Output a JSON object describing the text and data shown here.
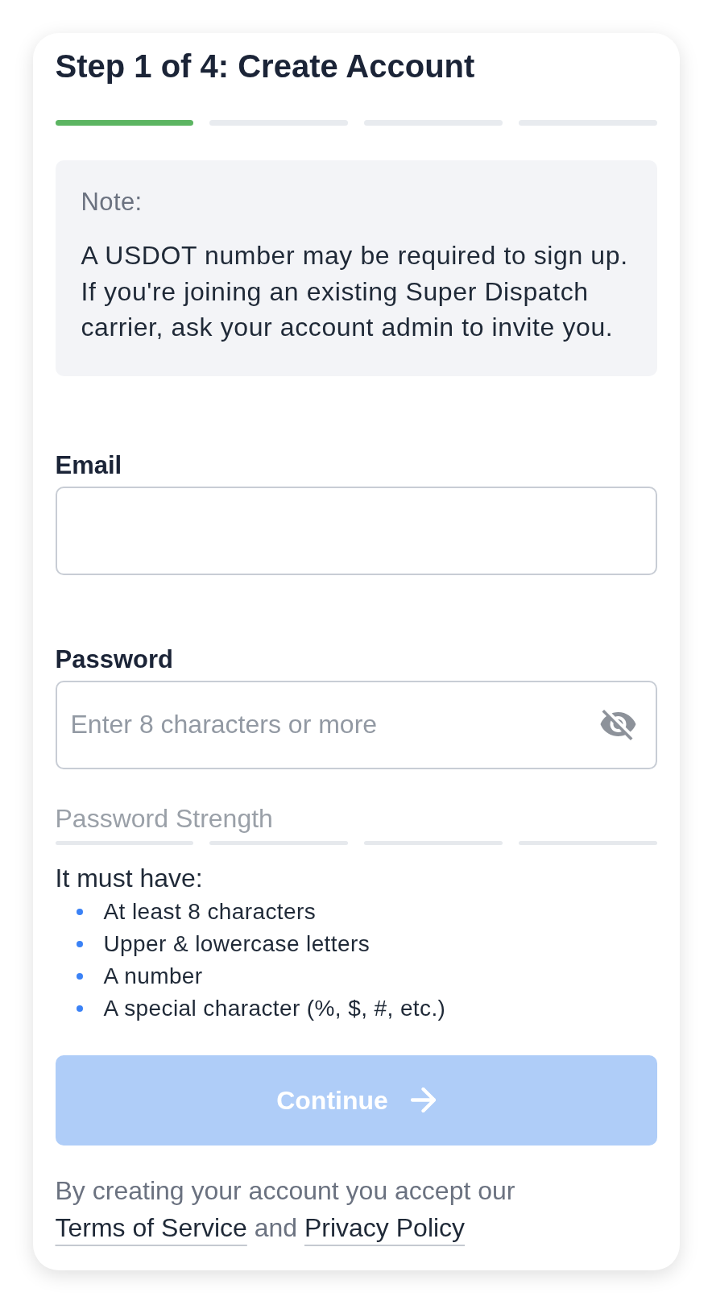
{
  "title": "Step 1 of 4: Create Account",
  "steps": [
    {
      "complete": true
    },
    {
      "complete": false
    },
    {
      "complete": false
    },
    {
      "complete": false
    }
  ],
  "note": {
    "label": "Note:",
    "text": "A USDOT number may be required to sign up. If you're joining an existing Super Dispatch carrier, ask your account admin to invite you."
  },
  "email": {
    "label": "Email"
  },
  "password": {
    "label": "Password",
    "placeholder": "Enter 8 characters or more",
    "show_password": false
  },
  "strength": {
    "label": "Password Strength",
    "segments": [
      {
        "filled": false
      },
      {
        "filled": false
      },
      {
        "filled": false
      },
      {
        "filled": false
      }
    ]
  },
  "requirements": {
    "heading": "It must have:",
    "items": [
      "At least 8 characters",
      "Upper & lowercase letters",
      "A number",
      "A special character (%, $, #, etc.)"
    ]
  },
  "continue_button": {
    "label": "Continue",
    "disabled": true
  },
  "legal": {
    "text": "By creating your account you accept our",
    "terms_link": "Terms of Service",
    "conjunction": "and",
    "privacy_link": "Privacy Policy"
  }
}
